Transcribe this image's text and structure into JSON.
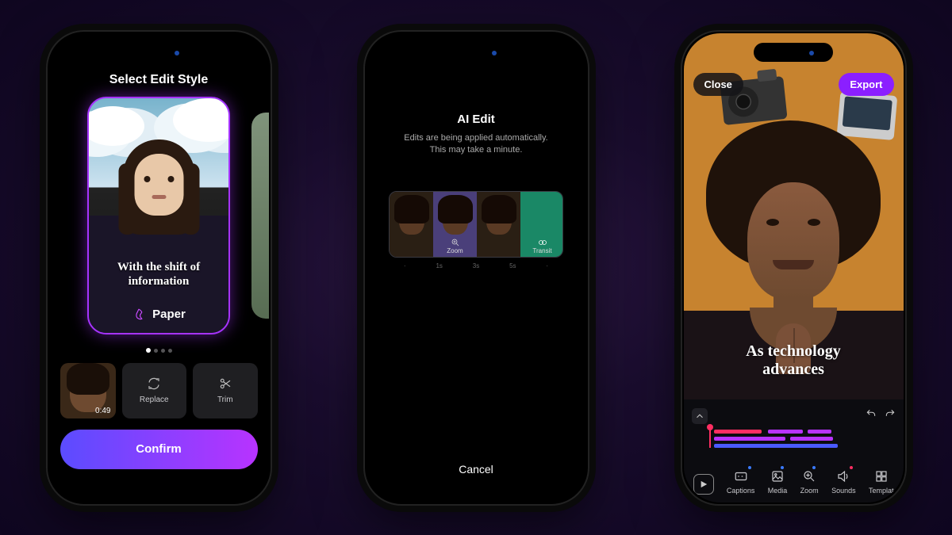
{
  "phone1": {
    "header": "Select Edit Style",
    "caption": "With the shift of information",
    "style_name": "Paper",
    "thumb_duration": "0:49",
    "tools": {
      "replace": "Replace",
      "trim": "Trim"
    },
    "confirm": "Confirm"
  },
  "phone2": {
    "title": "AI Edit",
    "subtitle_line1": "Edits are being applied automatically.",
    "subtitle_line2": "This may take a minute.",
    "segments": {
      "zoom": "Zoom",
      "transition": "Transit"
    },
    "ticks": {
      "a": "·",
      "b": "1s",
      "c": "3s",
      "d": "5s",
      "e": "·"
    },
    "cancel": "Cancel"
  },
  "phone3": {
    "close": "Close",
    "export": "Export",
    "caption_line1": "As technology",
    "caption_line2": "advances",
    "toolbar": {
      "captions": "Captions",
      "media": "Media",
      "zoom": "Zoom",
      "sounds": "Sounds",
      "templates": "Templat"
    }
  }
}
